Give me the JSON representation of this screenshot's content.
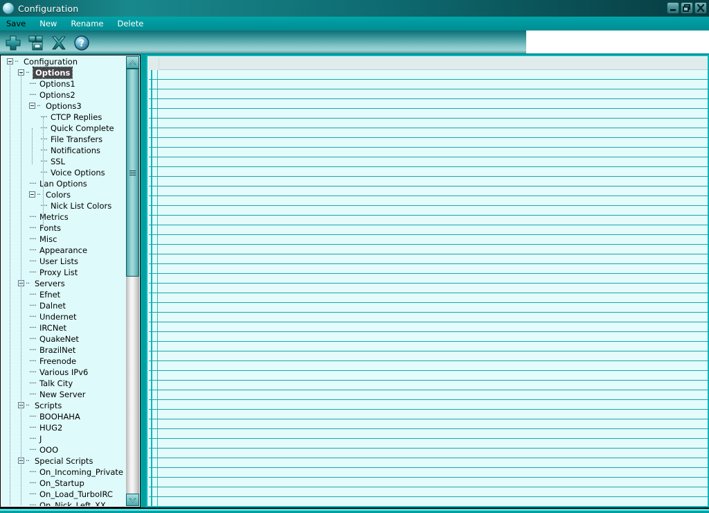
{
  "window": {
    "title": "Configuration",
    "icon": "sphere-icon",
    "controls": [
      {
        "name": "minimize",
        "glyph": "minimize-icon"
      },
      {
        "name": "restore",
        "glyph": "restore-icon"
      },
      {
        "name": "close",
        "glyph": "close-icon"
      }
    ]
  },
  "menubar": {
    "items": [
      {
        "label": "Save",
        "enabled": true
      },
      {
        "label": "New",
        "enabled": false
      },
      {
        "label": "Rename",
        "enabled": false
      },
      {
        "label": "Delete",
        "enabled": false
      }
    ]
  },
  "toolbar": {
    "buttons": [
      {
        "name": "add-icon",
        "title": "New"
      },
      {
        "name": "save-icon",
        "title": "Save"
      },
      {
        "name": "delete-icon",
        "title": "Delete"
      },
      {
        "name": "help-icon",
        "title": "Help"
      }
    ]
  },
  "tree": {
    "selected": "Options",
    "nodes": [
      {
        "label": "Configuration",
        "depth": 0,
        "expander": "minus"
      },
      {
        "label": "Options",
        "depth": 1,
        "expander": "minus",
        "selected": true
      },
      {
        "label": "Options1",
        "depth": 2,
        "expander": "leaf"
      },
      {
        "label": "Options2",
        "depth": 2,
        "expander": "leaf"
      },
      {
        "label": "Options3",
        "depth": 2,
        "expander": "minus"
      },
      {
        "label": "CTCP Replies",
        "depth": 3,
        "expander": "leaf"
      },
      {
        "label": "Quick Complete",
        "depth": 3,
        "expander": "leaf"
      },
      {
        "label": "File Transfers",
        "depth": 3,
        "expander": "leaf"
      },
      {
        "label": "Notifications",
        "depth": 3,
        "expander": "leaf"
      },
      {
        "label": "SSL",
        "depth": 3,
        "expander": "leaf"
      },
      {
        "label": "Voice Options",
        "depth": 3,
        "expander": "leaf"
      },
      {
        "label": "Lan Options",
        "depth": 2,
        "expander": "leaf"
      },
      {
        "label": "Colors",
        "depth": 2,
        "expander": "minus"
      },
      {
        "label": "Nick List Colors",
        "depth": 3,
        "expander": "leaf"
      },
      {
        "label": "Metrics",
        "depth": 2,
        "expander": "leaf"
      },
      {
        "label": "Fonts",
        "depth": 2,
        "expander": "leaf"
      },
      {
        "label": "Misc",
        "depth": 2,
        "expander": "leaf"
      },
      {
        "label": "Appearance",
        "depth": 2,
        "expander": "leaf"
      },
      {
        "label": "User Lists",
        "depth": 2,
        "expander": "leaf"
      },
      {
        "label": "Proxy List",
        "depth": 2,
        "expander": "leaf"
      },
      {
        "label": "Servers",
        "depth": 1,
        "expander": "minus"
      },
      {
        "label": "Efnet",
        "depth": 2,
        "expander": "leaf"
      },
      {
        "label": "Dalnet",
        "depth": 2,
        "expander": "leaf"
      },
      {
        "label": "Undernet",
        "depth": 2,
        "expander": "leaf"
      },
      {
        "label": "IRCNet",
        "depth": 2,
        "expander": "leaf"
      },
      {
        "label": "QuakeNet",
        "depth": 2,
        "expander": "leaf"
      },
      {
        "label": "BrazilNet",
        "depth": 2,
        "expander": "leaf"
      },
      {
        "label": "Freenode",
        "depth": 2,
        "expander": "leaf"
      },
      {
        "label": "Various IPv6",
        "depth": 2,
        "expander": "leaf"
      },
      {
        "label": "Talk City",
        "depth": 2,
        "expander": "leaf"
      },
      {
        "label": "New Server",
        "depth": 2,
        "expander": "leaf"
      },
      {
        "label": "Scripts",
        "depth": 1,
        "expander": "minus"
      },
      {
        "label": "BOOHAHA",
        "depth": 2,
        "expander": "leaf"
      },
      {
        "label": "HUG2",
        "depth": 2,
        "expander": "leaf"
      },
      {
        "label": "J",
        "depth": 2,
        "expander": "leaf"
      },
      {
        "label": "OOO",
        "depth": 2,
        "expander": "leaf"
      },
      {
        "label": "Special Scripts",
        "depth": 1,
        "expander": "minus"
      },
      {
        "label": "On_Incoming_Private",
        "depth": 2,
        "expander": "leaf"
      },
      {
        "label": "On_Startup",
        "depth": 2,
        "expander": "leaf"
      },
      {
        "label": "On_Load_TurboIRC",
        "depth": 2,
        "expander": "leaf"
      },
      {
        "label": "On_Nick_Left_XX",
        "depth": 2,
        "expander": "leaf"
      }
    ],
    "scrollbar": {
      "up_arrow": "chevron-up-icon",
      "down_arrow": "chevron-down-icon",
      "thumb_top_pct": 0,
      "thumb_height_pct": 49
    }
  },
  "grid": {
    "header_label": "",
    "row_count": 45,
    "rows": []
  },
  "colors": {
    "accent": "#00a0a0",
    "titlebar": "#0d6a70",
    "grid_border": "#00b7bd",
    "grid_row_line": "#1aa5aa",
    "tree_bg": "#dffafa",
    "selection": "#46464a"
  }
}
